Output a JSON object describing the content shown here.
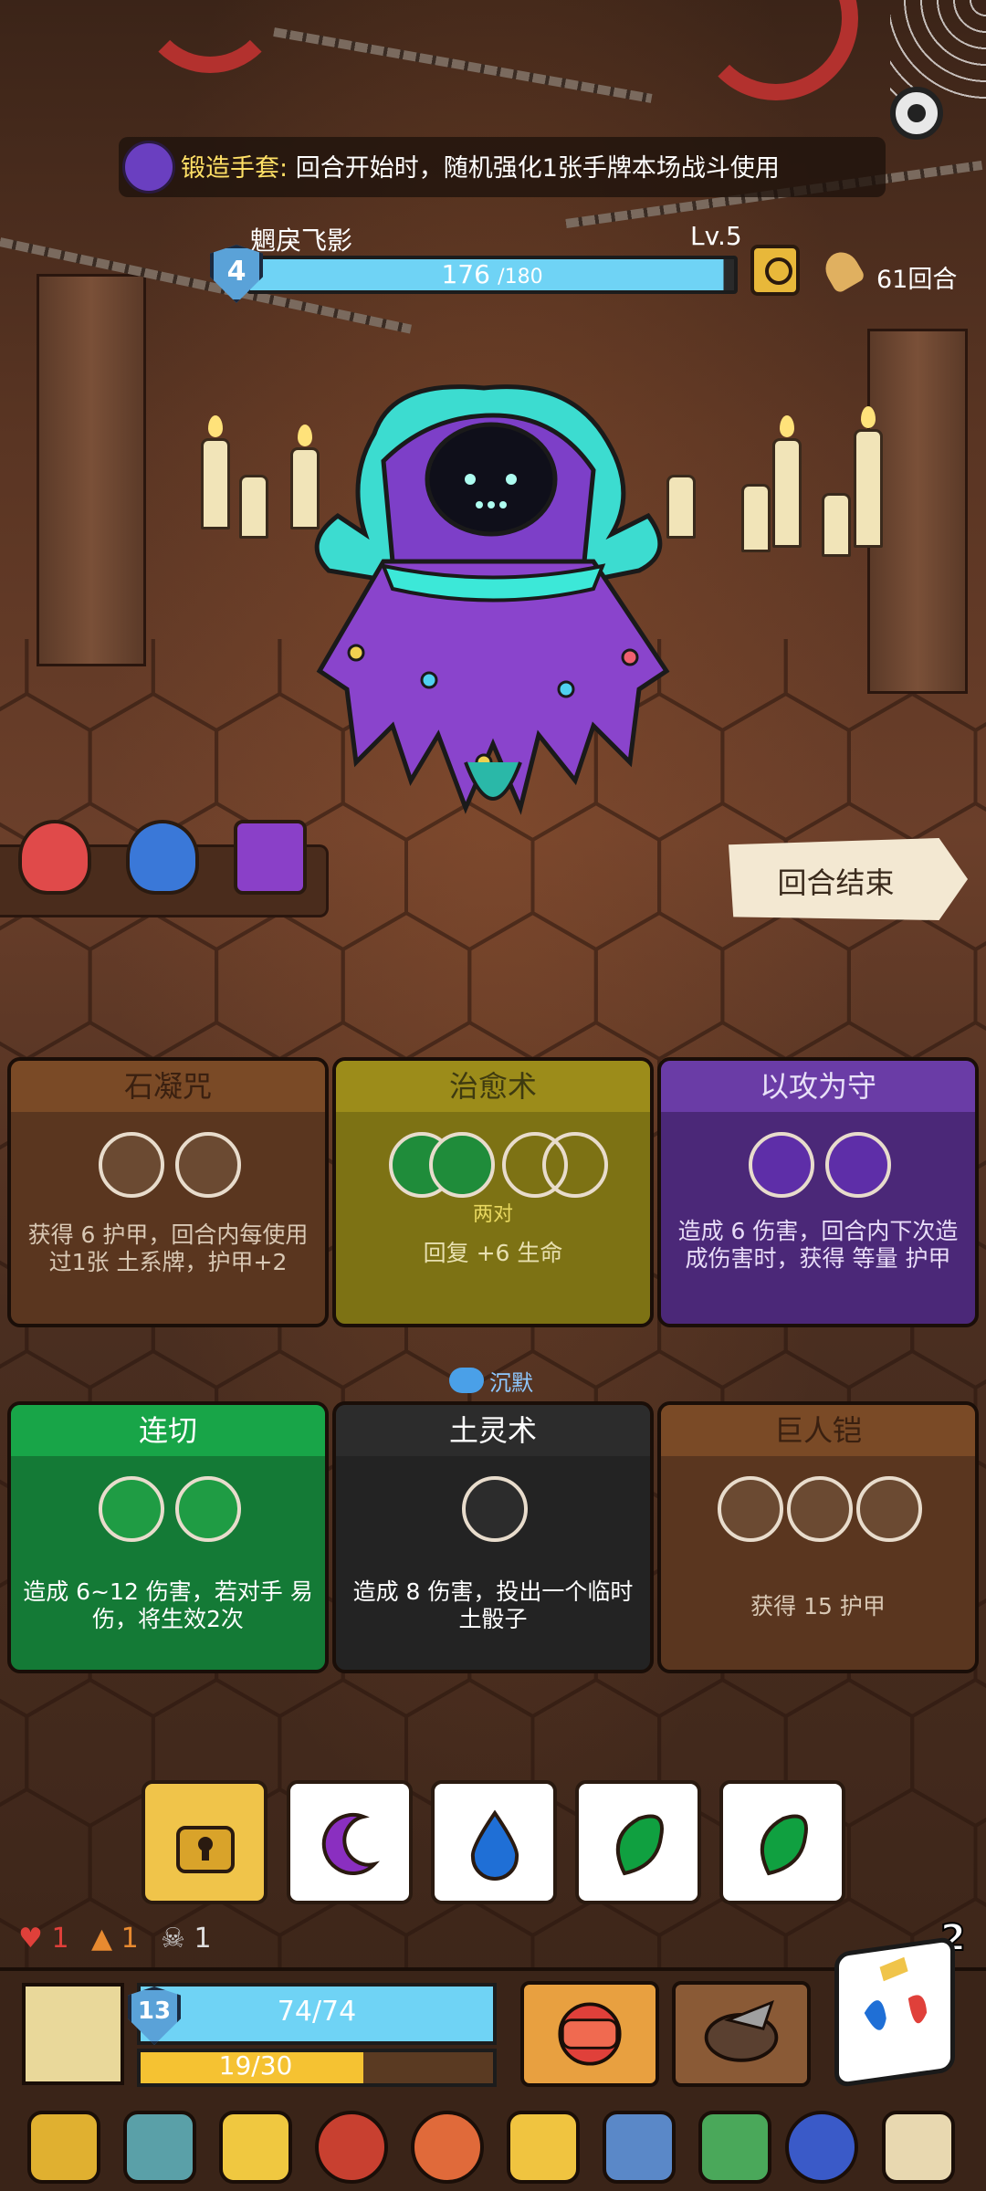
{
  "relic": {
    "name": "锻造手套:",
    "desc": "回合开始时，随机强化1张手牌本场战斗使用"
  },
  "enemy": {
    "name": "魍戾飞影",
    "level": "Lv.5",
    "shield": "4",
    "hp": "176",
    "hp_max": "/180",
    "hp_fraction": 0.978
  },
  "turns": "61回合",
  "end_turn": "回合结束",
  "cards": [
    {
      "title": "石凝咒",
      "color": "brown",
      "desc": "获得 6 护甲，回合内每使用过1张 土系牌，护甲+2"
    },
    {
      "title": "治愈术",
      "color": "olive",
      "sub": "两对",
      "desc": "回复 +6 生命"
    },
    {
      "title": "以攻为守",
      "color": "purple",
      "desc": "造成 6 伤害，回合内下次造成伤害时，获得 等量 护甲"
    },
    {
      "title": "连切",
      "color": "green",
      "desc": "造成 6~12 伤害，若对手 易伤，将生效2次"
    },
    {
      "title": "土灵术",
      "color": "dark",
      "desc": "造成 8 伤害，投出一个临时土骰子"
    },
    {
      "title": "巨人铠",
      "color": "brown",
      "desc": "获得 15 护甲"
    }
  ],
  "silence_label": "沉默",
  "dice": [
    {
      "type": "lock",
      "icon": "lock-icon"
    },
    {
      "type": "moon",
      "icon": "moon-icon",
      "color": "#8a2fc0"
    },
    {
      "type": "water",
      "icon": "water-drop-icon",
      "color": "#1f6fd6"
    },
    {
      "type": "leaf",
      "icon": "leaf-icon",
      "color": "#10a040"
    },
    {
      "type": "leaf",
      "icon": "leaf-icon",
      "color": "#10a040"
    }
  ],
  "status": {
    "hearts": "1",
    "flames": "1",
    "skulls": "1",
    "dice_count": "2"
  },
  "player": {
    "shield": "13",
    "hp": "74/74",
    "energy": "19/30",
    "energy_fraction": 0.633
  },
  "items": [
    "orb-icon",
    "vase-icon",
    "cheese-icon",
    "sun-mask-icon",
    "meat-icon",
    "heart-gem-icon",
    "sword-icon",
    "green-card-icon",
    "demon-icon",
    "dragon-scroll-icon"
  ]
}
